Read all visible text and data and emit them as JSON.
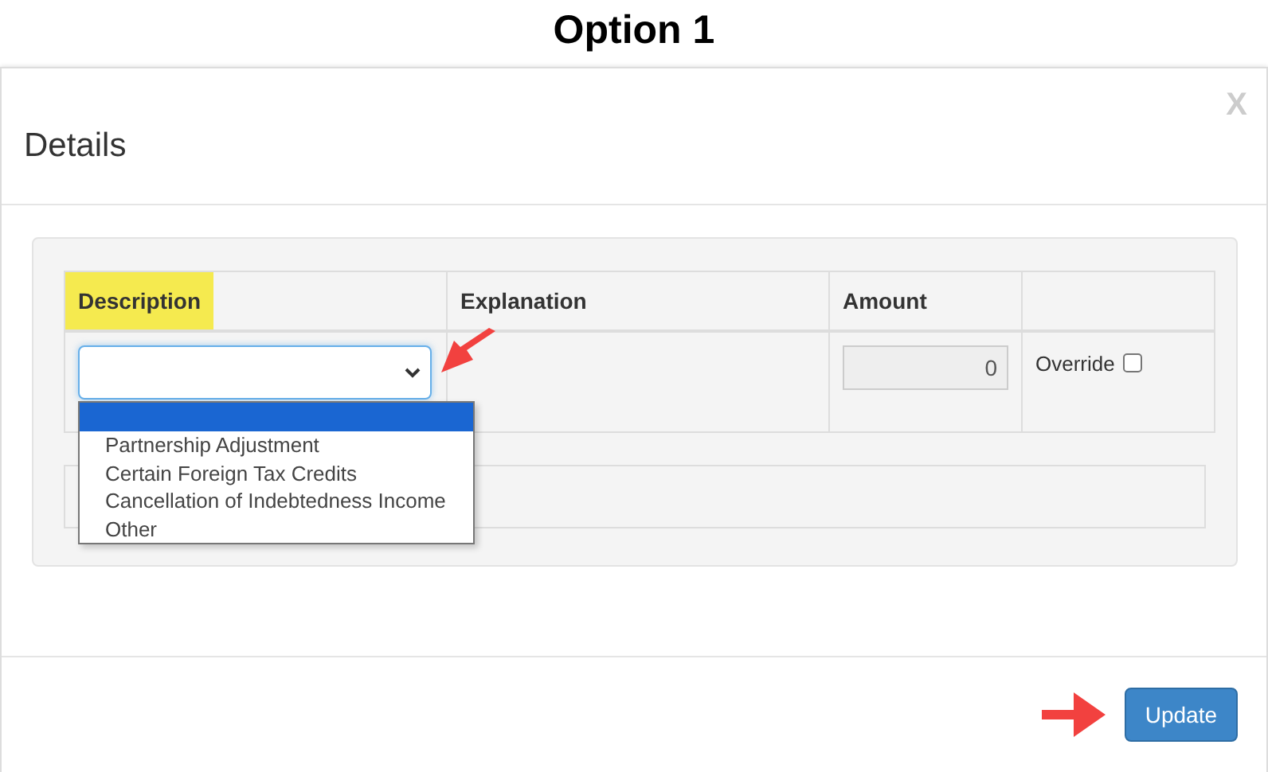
{
  "page_title": "Option 1",
  "modal": {
    "title": "Details",
    "close": "X"
  },
  "table": {
    "columns": [
      {
        "label": "Description",
        "highlighted": true
      },
      {
        "label": "Explanation",
        "highlighted": false
      },
      {
        "label": "Amount",
        "highlighted": false
      }
    ],
    "row": {
      "amount": "0",
      "override_label": "Override",
      "override_checked": false
    }
  },
  "dropdown": {
    "open": true,
    "blank_option_selected": true,
    "options": [
      {
        "label": "Partnership Adjustment",
        "selected": false
      },
      {
        "label": "Certain Foreign Tax Credits",
        "selected": false
      },
      {
        "label": "Cancellation of Indebtedness Income",
        "selected": false
      },
      {
        "label": "Other",
        "selected": false
      }
    ]
  },
  "buttons": [
    {
      "label": "Update"
    }
  ]
}
